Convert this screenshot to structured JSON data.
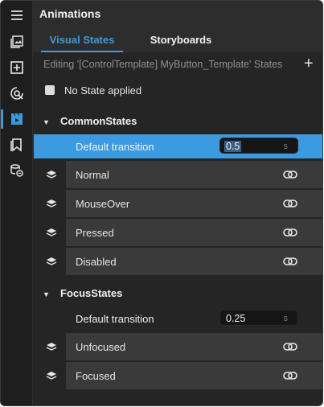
{
  "header": {
    "title": "Animations"
  },
  "tabs": [
    {
      "label": "Visual States",
      "active": true
    },
    {
      "label": "Storyboards",
      "active": false
    }
  ],
  "editing_label": "Editing '[ControlTemplate] MyButton_Template' States",
  "add_label": "+",
  "no_state": {
    "label": "No State applied",
    "checked": false
  },
  "groups": [
    {
      "name": "CommonStates",
      "transition": {
        "label": "Default transition",
        "value": "0.5",
        "unit": "s"
      },
      "states": [
        "Normal",
        "MouseOver",
        "Pressed",
        "Disabled"
      ]
    },
    {
      "name": "FocusStates",
      "transition": {
        "label": "Default transition",
        "value": "0.25",
        "unit": "s"
      },
      "states": [
        "Unfocused",
        "Focused"
      ]
    }
  ],
  "rail_icons": [
    "menu-icon",
    "assets-icon",
    "add-icon",
    "data-icon",
    "animations-icon",
    "bookmarks-icon",
    "resources-icon"
  ],
  "colors": {
    "accent": "#3c9be0",
    "panel": "#252525",
    "row": "#3a3a3a"
  }
}
